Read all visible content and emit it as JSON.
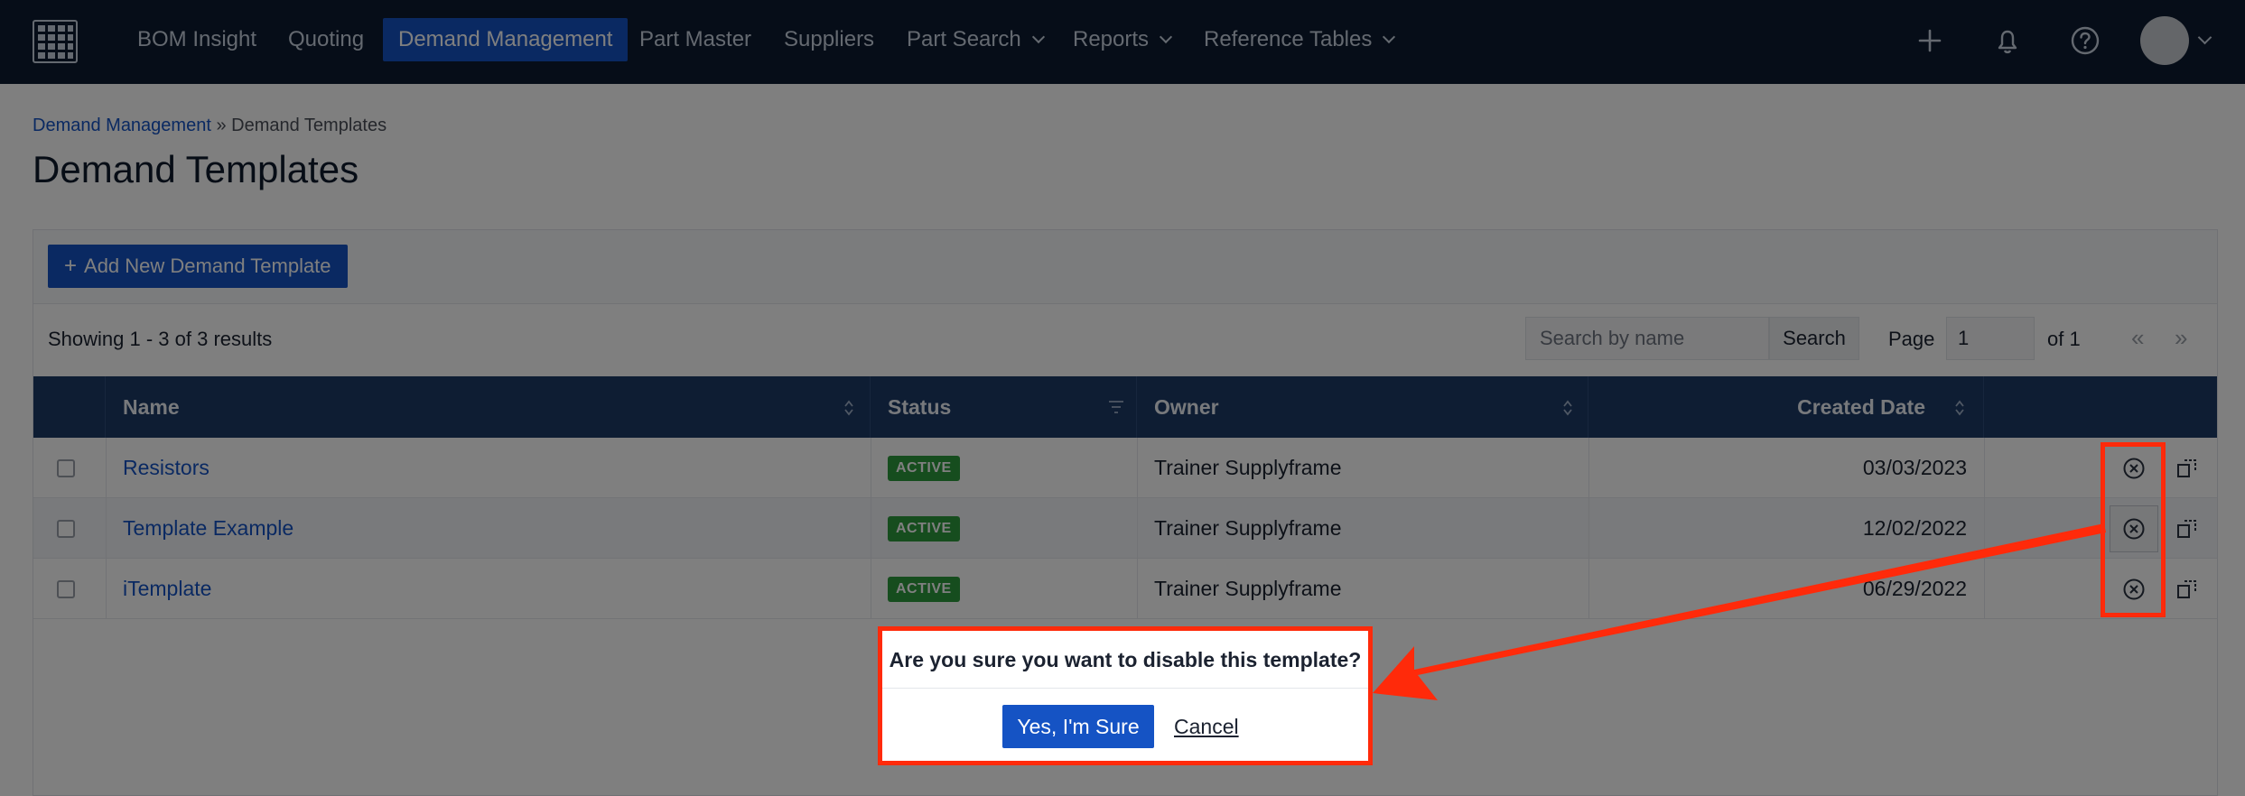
{
  "nav": {
    "items": [
      {
        "label": "BOM Insight"
      },
      {
        "label": "Quoting"
      },
      {
        "label": "Demand Management"
      },
      {
        "label": "Part Master"
      },
      {
        "label": "Suppliers"
      },
      {
        "label": "Part Search"
      },
      {
        "label": "Reports"
      },
      {
        "label": "Reference Tables"
      }
    ],
    "active_item": "Demand Management",
    "icons": [
      "plus-icon",
      "bell-icon",
      "help-icon"
    ]
  },
  "breadcrumb": {
    "parent": "Demand Management",
    "separator": "»",
    "current": "Demand Templates"
  },
  "page_title": "Demand Templates",
  "toolbar": {
    "add_button_icon": "+",
    "add_button_label": "Add New Demand Template"
  },
  "results": {
    "summary": "Showing 1 - 3 of 3 results",
    "search_placeholder": "Search by name",
    "search_button": "Search",
    "page_label": "Page",
    "page_value": "1",
    "page_total": "of 1",
    "prev": "«",
    "next": "»"
  },
  "table": {
    "headers": {
      "name": "Name",
      "status": "Status",
      "owner": "Owner",
      "created": "Created Date"
    },
    "rows": [
      {
        "name": "Resistors",
        "status": "ACTIVE",
        "owner": "Trainer Supplyframe",
        "created": "03/03/2023"
      },
      {
        "name": "Template Example",
        "status": "ACTIVE",
        "owner": "Trainer Supplyframe",
        "created": "12/02/2022"
      },
      {
        "name": "iTemplate",
        "status": "ACTIVE",
        "owner": "Trainer Supplyframe",
        "created": "06/29/2022"
      }
    ]
  },
  "dialog": {
    "question": "Are you sure you want to disable this template?",
    "confirm": "Yes, I'm Sure",
    "cancel": "Cancel"
  },
  "colors": {
    "nav_bg": "#0d1b30",
    "accent": "#1553c4",
    "table_header": "#1d3a66",
    "status_active": "#2c9a3d",
    "annotation": "#ff2a0a"
  }
}
